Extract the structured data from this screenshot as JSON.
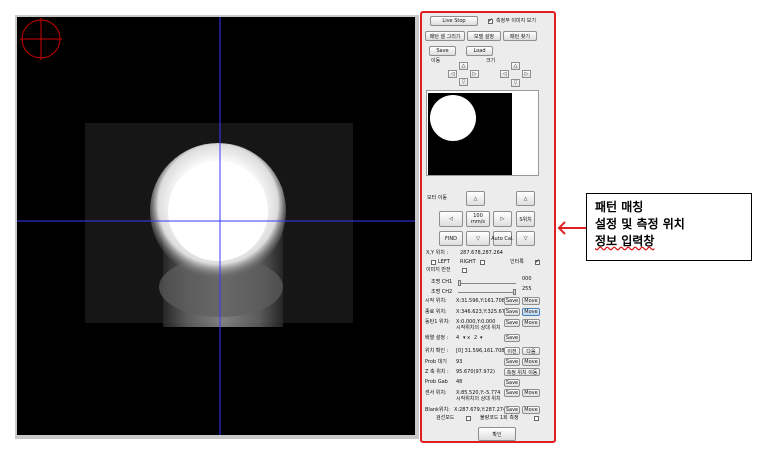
{
  "panel": {
    "live_stop": "Live Stop",
    "show_measure_image": "측정부 이미지 보기",
    "show_measure_image_checked": true,
    "pattern_set_draw": "패턴 셀 그리기",
    "model_set": "모델 설정",
    "pattern_find": "패턴 찾기",
    "save": "Save",
    "load": "Load",
    "move_label": "이동",
    "size_label": "크기",
    "motor_move": "모터 이동",
    "speed_value": "100",
    "speed_unit": "mm/s",
    "find": "FIND",
    "auto_cal": "Auto Cal.",
    "s_pos": "S위치",
    "xy_pos_label": "X,Y 위치 :",
    "xy_pos_value": "287.678,287.264",
    "left_label": "LEFT",
    "right_label": "RIGHT",
    "interlock_label": "인터록",
    "interlock_checked": true,
    "image_invert": "이미지 반전",
    "light_ch1": "조명 CH1",
    "light_ch1_value": "000",
    "light_ch2": "조명 CH2",
    "light_ch2_value": "255",
    "rows": [
      {
        "label": "시작 위치:",
        "value": "X:31.596,Y:161.708",
        "btn1": "Save",
        "btn2": "Move"
      },
      {
        "label": "종료 위치:",
        "value": "X:346.623,Y:325.678",
        "btn1": "Save",
        "btn2": "Move"
      },
      {
        "label": "동탄1 위치:",
        "value": "X:0.000,Y:0.000",
        "btn1": "Save",
        "btn2": "Move"
      }
    ],
    "relative_pos_note": "시작위치의 상대 위치",
    "array_setting": "배열 설정 :",
    "array_x": "4",
    "array_y": "2",
    "array_save": "Save",
    "pos_check": "위치 확인 :",
    "pos_check_value": "[0] 31.596,161.708",
    "prev": "이전",
    "next": "다음",
    "probe_wait": "Prob 대기",
    "probe_wait_value": "93",
    "probe_save": "Save",
    "probe_move": "Move",
    "z_pos": "Z 축 위치 :",
    "z_pos_value": "95.670(97.972)",
    "measure_pos_move": "측정 위치 이동",
    "probe_gab": "Prob Gab",
    "probe_gab_value": "48",
    "probe_gab_save": "Save",
    "sensor_pos": "센서 위치:",
    "sensor_pos_value": "X:85.520,Y:-5.774",
    "sensor_save": "Save",
    "sensor_move": "Move",
    "sensor_note": "시작위치의 상대 위치",
    "blank_pos": "Blank위치:",
    "blank_pos_value": "X:287.679,Y:287.274",
    "blank_save": "Save",
    "blank_move": "Move",
    "check_mode": "검선모드",
    "bad_code_measure": "불량코드 1회 측정",
    "confirm": "확인"
  },
  "callout": {
    "line1": "패턴 매칭",
    "line2": "설정 및 측정 위치",
    "line3": "정보 입력창"
  },
  "colors": {
    "highlight": "#e02020",
    "crosshair": "#3a3aff",
    "marker": "#cc0000"
  }
}
